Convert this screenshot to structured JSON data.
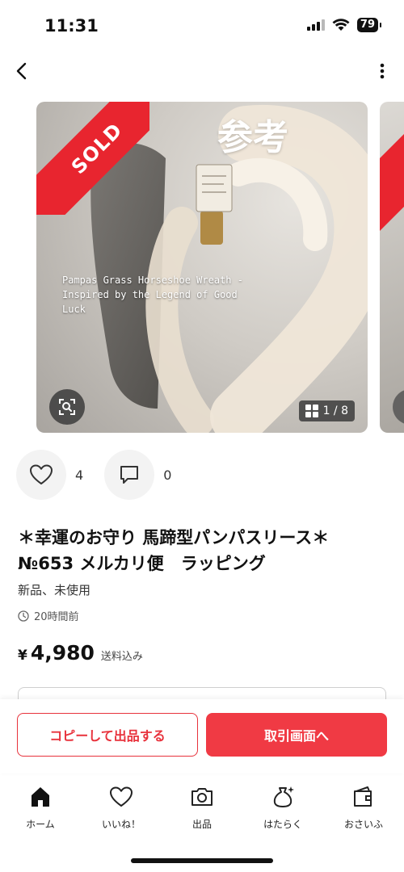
{
  "status_bar": {
    "time": "11:31",
    "battery": "79"
  },
  "carousel": {
    "sold_label": "SOLD",
    "reference_label": "参考",
    "caption": "Pampas Grass Horseshoe Wreath - Inspired by the Legend of Good Luck",
    "counter": "1 / 8"
  },
  "reactions": {
    "likes_count": "4",
    "comments_count": "0"
  },
  "item": {
    "title": "＊幸運のお守り 馬蹄型パンパスリース＊ №653 メルカリ便　ラッピング",
    "condition": "新品、未使用",
    "posted": "20時間前",
    "price_symbol": "¥",
    "price": "4,980",
    "shipping_note": "送料込み"
  },
  "actions": {
    "copy_label": "コピーして出品する",
    "trade_label": "取引画面へ"
  },
  "colors": {
    "accent": "#f03a44",
    "sold_ribbon": "#e8252f"
  },
  "tabs": [
    {
      "label": "ホーム",
      "icon": "home-icon"
    },
    {
      "label": "いいね！",
      "icon": "heart-icon"
    },
    {
      "label": "出品",
      "icon": "camera-icon"
    },
    {
      "label": "はたらく",
      "icon": "money-bag-icon"
    },
    {
      "label": "おさいふ",
      "icon": "wallet-icon"
    }
  ]
}
